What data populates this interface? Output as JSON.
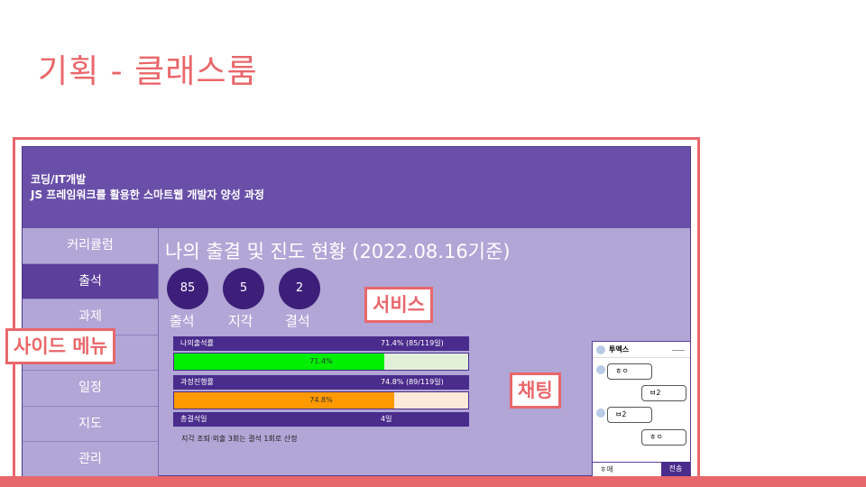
{
  "slide": {
    "title": "기획 - 클래스룸"
  },
  "app": {
    "header": {
      "category": "코딩/IT개발",
      "course": "JS 프레임워크를 활용한 스마트웹 개발자 양성 과정"
    },
    "sidebar": {
      "items": [
        {
          "label": "커리큘럼",
          "active": false
        },
        {
          "label": "출석",
          "active": true
        },
        {
          "label": "과제",
          "active": false
        },
        {
          "label": "",
          "active": false
        },
        {
          "label": "일정",
          "active": false
        },
        {
          "label": "지도",
          "active": false
        },
        {
          "label": "관리",
          "active": false
        }
      ]
    },
    "main": {
      "title": "나의 출결 및 진도 현황 (2022.08.16기준)",
      "stats": [
        {
          "value": "85",
          "label": "출석"
        },
        {
          "value": "5",
          "label": "지각"
        },
        {
          "value": "2",
          "label": "결석"
        }
      ],
      "attendance": {
        "label": "나의출석률",
        "value": "71.4% (85/119일)",
        "bar_text": "71.4%",
        "percent": 71.4,
        "color": "#00ee00",
        "track": "#e2f0d9"
      },
      "progress": {
        "label": "과정진행률",
        "value": "74.8% (89/119일)",
        "bar_text": "74.8%",
        "percent": 74.8,
        "color": "#ff9900",
        "track": "#fde9d9"
      },
      "absence": {
        "label": "총결석일",
        "value": "4일"
      },
      "note": "지각 조퇴·외출 3회는 결석 1회로 산정"
    },
    "chat": {
      "name": "투엑스",
      "messages": [
        {
          "text": "ㅎㅇ",
          "side": "left"
        },
        {
          "text": "ㅂ2",
          "side": "right"
        },
        {
          "text": "ㅂ2",
          "side": "left"
        },
        {
          "text": "ㅎㅇ",
          "side": "right"
        }
      ],
      "input_value": "ㅎ애",
      "send_label": "전송"
    }
  },
  "callouts": {
    "service": "서비스",
    "side_menu": "사이드 메뉴",
    "chatting": "채팅"
  },
  "colors": {
    "accent": "#e8676b",
    "header": "#6a4fa8",
    "panel": "#b1a6d6",
    "dark_circle": "#3d1f7a"
  }
}
